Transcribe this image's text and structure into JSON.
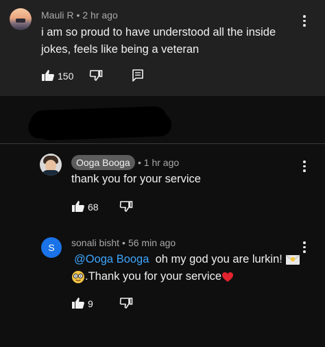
{
  "comments": [
    {
      "author": "Mauli R",
      "separator": "•",
      "time": "2 hr ago",
      "text_line1": "i am so proud to have understood all the inside",
      "text_line2": "jokes, feels like being a veteran",
      "likes": "150"
    }
  ],
  "replies": [
    {
      "author": "Ooga Booga",
      "separator": "•",
      "time": "1 hr ago",
      "text": "thank you for your service",
      "likes": "68"
    },
    {
      "avatar_letter": "S",
      "author": "sonali bisht",
      "separator": "•",
      "time": "56 min ago",
      "mention": "@Ooga Booga",
      "text_line1": "oh my god you are lurkin!",
      "text_line2": ".Thank you for your service",
      "likes": "9"
    }
  ],
  "icons": {
    "like": "thumbs-up-icon",
    "dislike": "thumbs-down-icon",
    "reply": "reply-icon",
    "more": "more-vert-icon"
  },
  "colors": {
    "background": "#0f0f0f",
    "top_card": "#212121",
    "mention": "#3ea6ff",
    "avatar_s": "#1a73e8",
    "name_chip": "#5c5c5c"
  }
}
